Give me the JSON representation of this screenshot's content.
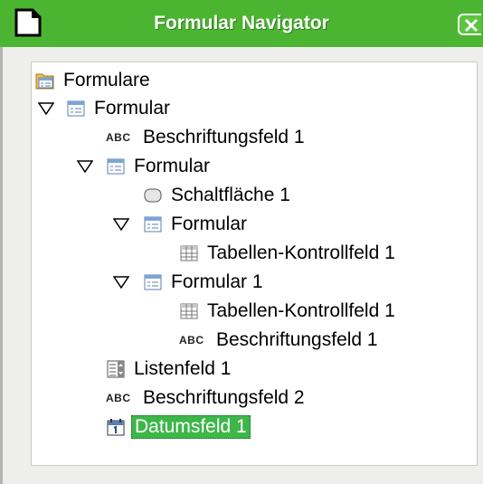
{
  "window": {
    "title": "Formular Navigator"
  },
  "tree": {
    "root": "Formulare",
    "form1": "Formular",
    "label1": "Beschriftungsfeld 1",
    "form2": "Formular",
    "button1": "Schaltfläche 1",
    "form3": "Formular",
    "table1": "Tabellen-Kontrollfeld  1",
    "form4": "Formular 1",
    "table2": "Tabellen-Kontrollfeld  1",
    "label2": "Beschriftungsfeld 1",
    "listbox1": "Listenfeld 1",
    "label3": "Beschriftungsfeld 2",
    "date1": "Datumsfeld 1",
    "abc": "ABC"
  },
  "colors": {
    "titlebar": "#4bb531",
    "selection": "#3db64a"
  }
}
